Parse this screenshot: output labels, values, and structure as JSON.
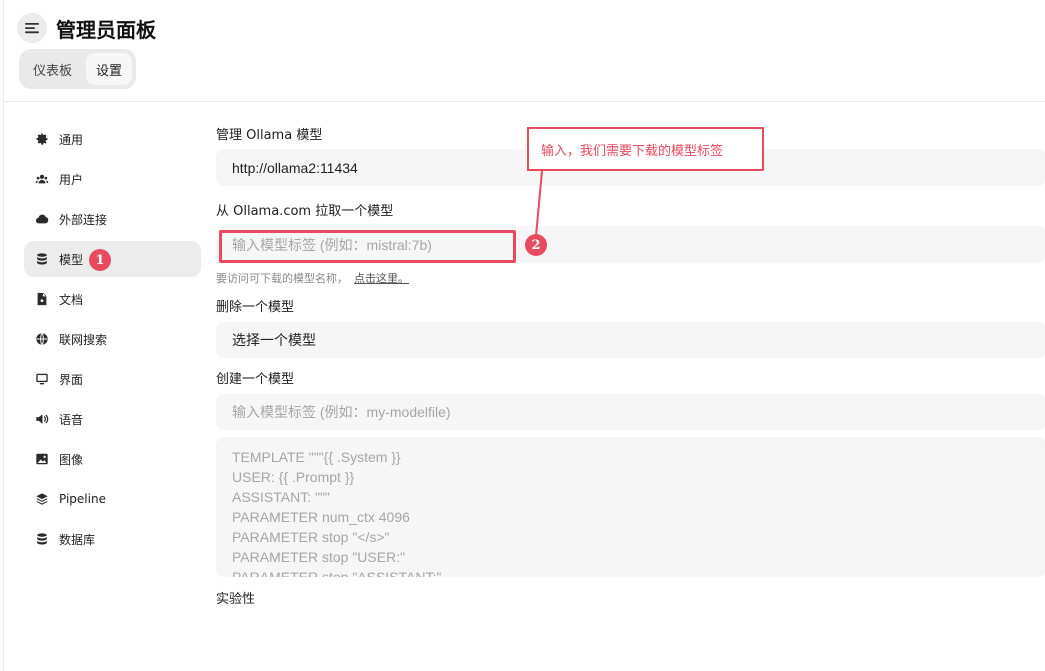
{
  "header": {
    "menu_icon": "hamburger-icon",
    "title": "管理员面板",
    "tabs": [
      {
        "label": "仪表板",
        "active": false
      },
      {
        "label": "设置",
        "active": true
      }
    ]
  },
  "sidebar": {
    "items": [
      {
        "label": "通用",
        "icon": "gear-icon"
      },
      {
        "label": "用户",
        "icon": "users-icon"
      },
      {
        "label": "外部连接",
        "icon": "cloud-icon"
      },
      {
        "label": "模型",
        "icon": "database-icon",
        "active": true
      },
      {
        "label": "文档",
        "icon": "document-icon"
      },
      {
        "label": "联网搜索",
        "icon": "globe-icon"
      },
      {
        "label": "界面",
        "icon": "monitor-icon"
      },
      {
        "label": "语音",
        "icon": "speaker-icon"
      },
      {
        "label": "图像",
        "icon": "image-icon"
      },
      {
        "label": "Pipeline",
        "icon": "layers-icon"
      },
      {
        "label": "数据库",
        "icon": "database-icon"
      }
    ]
  },
  "main": {
    "manage_label": "管理 Ollama 模型",
    "ollama_url": "http://ollama2:11434",
    "pull_label": "从 Ollama.com 拉取一个模型",
    "pull_placeholder": "输入模型标签 (例如：mistral:7b)",
    "pull_hint": "要访问可下载的模型名称，",
    "pull_hint_link": "点击这里。",
    "delete_label": "删除一个模型",
    "delete_select": "选择一个模型",
    "create_label": "创建一个模型",
    "create_placeholder": "输入模型标签 (例如：my-modelfile)",
    "modelfile_placeholder": "TEMPLATE \"\"\"{{ .System }}\nUSER: {{ .Prompt }}\nASSISTANT: \"\"\"\nPARAMETER num_ctx 4096\nPARAMETER stop \"</s>\"\nPARAMETER stop \"USER:\"\nPARAMETER stop \"ASSISTANT:\"",
    "experimental_label": "实验性"
  },
  "annotations": {
    "badge_1": "1",
    "badge_2": "2",
    "callout": "输入，我们需要下载的模型标签",
    "color": "#e84a5f"
  }
}
